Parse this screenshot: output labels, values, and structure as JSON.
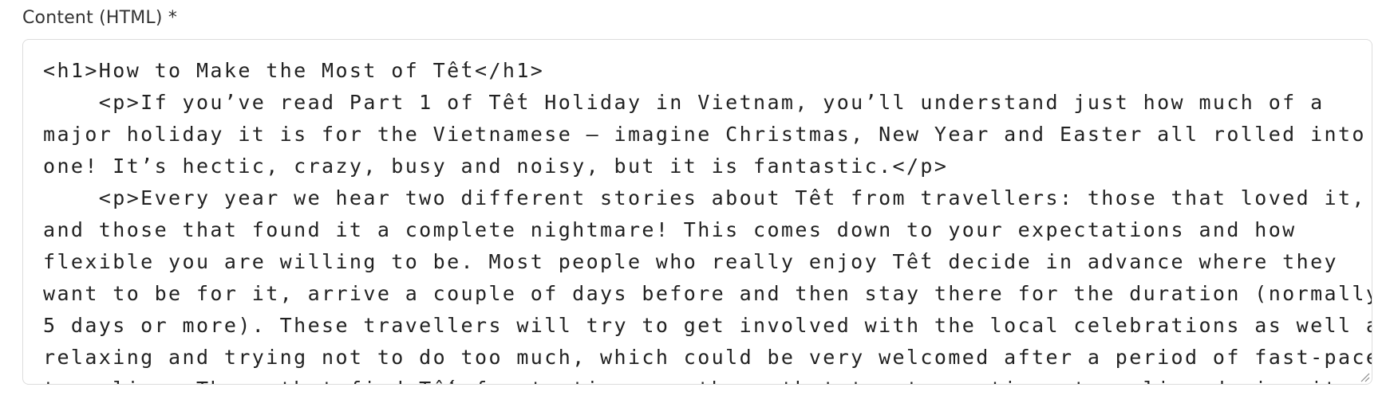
{
  "field": {
    "label": "Content (HTML) *"
  },
  "editor": {
    "lines": [
      "<h1>How to Make the Most of Tết</h1>",
      "    <p>If you’ve read Part 1 of Tết Holiday in Vietnam, you’ll understand just how much of a",
      "major holiday it is for the Vietnamese – imagine Christmas, New Year and Easter all rolled into",
      "one! It’s hectic, crazy, busy and noisy, but it is fantastic.</p>",
      "    <p>Every year we hear two different stories about Tết from travellers: those that loved it,",
      "and those that found it a complete nightmare! This comes down to your expectations and how",
      "flexible you are willing to be. Most people who really enjoy Tết decide in advance where they",
      "want to be for it, arrive a couple of days before and then stay there for the duration (normally",
      "5 days or more). These travellers will try to get involved with the local celebrations as well as",
      "relaxing and trying not to do too much, which could be very welcomed after a period of fast-paced",
      "traveling. Those that find Tết frustrating are those that try to continue traveling during it and"
    ],
    "resize_icon": "resize-grip-icon"
  }
}
